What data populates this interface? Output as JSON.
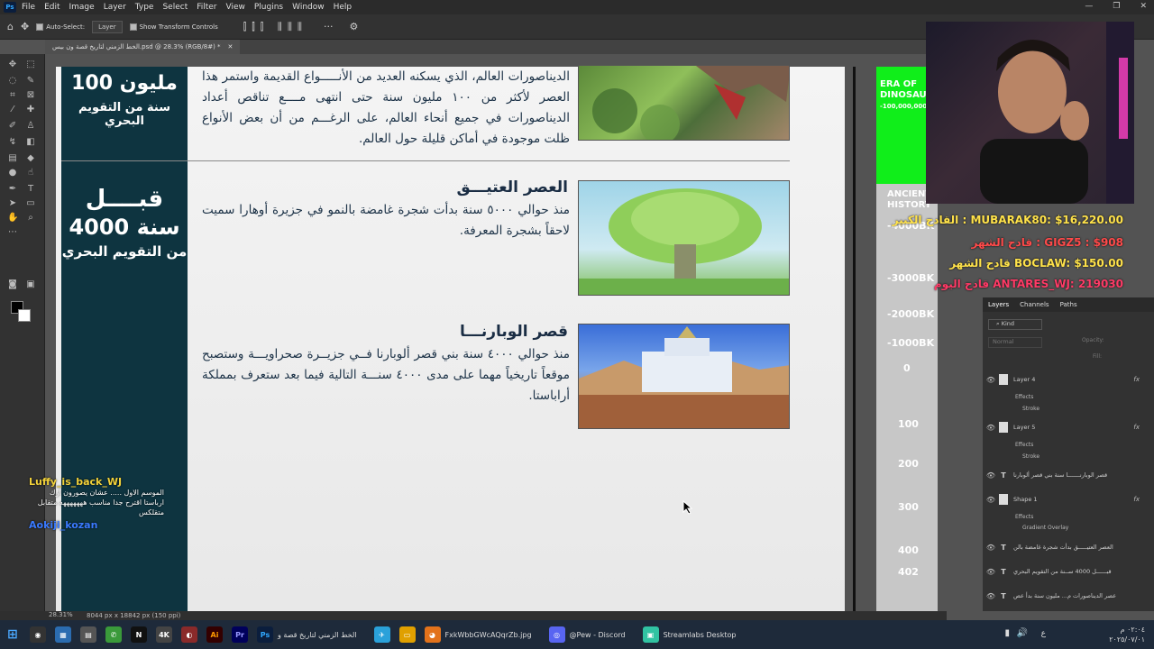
{
  "app": {
    "menu": [
      "File",
      "Edit",
      "Image",
      "Layer",
      "Type",
      "Select",
      "Filter",
      "View",
      "Plugins",
      "Window",
      "Help"
    ]
  },
  "options": {
    "auto_select_label": "Auto-Select:",
    "auto_select_value": "Layer",
    "transform_label": "Show Transform Controls"
  },
  "document": {
    "tab_title": "الخط الزمني لتاريخ قصة ون بيس.psd @ 28.3% (RGB/8#) *",
    "zoom": "28.31%",
    "doc_info": "8044 px x 18842 px (150 ppi)"
  },
  "canvas": {
    "side_top_big": "100 مليون",
    "side_top_small": "سنة من التقويم البحري",
    "side_mid_big1": "قبــــل",
    "side_mid_big2": "4000 سنة",
    "side_mid_small": "من التقويم البحري",
    "sections": [
      {
        "title": "",
        "body": "الديناصورات العالم، الذي يسكنه العديد من الأنـــــواع القديمة واستمر هذا العصر لأكثر من ١٠٠ مليون سنة حتى انتهى مــــع تناقص أعداد الديناصورات في جميع أنحاء العالم، على الرغـــم من أن بعض الأنواع ظلت موجودة في أماكن قليلة حول العالم."
      },
      {
        "title": "العصر العتيـــق",
        "body": "منذ حوالي ٥٠٠٠ سنة بدأت شجرة غامضة بالنمو في جزيرة أوهارا سميت لاحقاً بشجرة المعرفة."
      },
      {
        "title": "قصر الوبارنـــا",
        "body": "منذ حوالي ٤٠٠٠ سنة بني قصر ألوبارنا فــي جزيــرة صحراويـــة وستصبح موقعاً تاريخياً مهما على مدى ٤٠٠٠ سنـــة التالية فيما بعد ستعرف بمملكة أراباستا."
      }
    ]
  },
  "timeline": {
    "era_header": "ERA OF DINOSAURS",
    "era_years": "-100,000,000",
    "ancient": "ANCIENT HISTORY",
    "marks": [
      "-4000BK",
      "-3000BK",
      "-2000BK",
      "-1000BK",
      "0",
      "100",
      "200",
      "300",
      "400",
      "402"
    ]
  },
  "stream": {
    "donations": [
      {
        "text": "القادح الكبير : MUBARAK80: $16,220.00",
        "color": "#ffe24a"
      },
      {
        "text": "قادح الشهر : GIGZ5 : $908",
        "color": "#ff4a4a"
      },
      {
        "text": "قادح الشهر BOCLAW: $150.00",
        "color": "#ffe24a"
      },
      {
        "text": "قادح اليوم ANTARES_WJ: 219030",
        "color": "#ff3a66"
      }
    ],
    "chat": [
      {
        "user": "Luffy_is_back_WJ",
        "msg": "الموسم الاول ..... عشان يصورون ارك ارباستا اقترح جدا مناسب هههههههه متقابل متقلكس"
      },
      {
        "user": "Aokiji_kozan",
        "msg": ""
      }
    ]
  },
  "layers_panel": {
    "tabs": [
      "Layers",
      "Channels",
      "Paths"
    ],
    "filter": "Kind",
    "blend": "Normal",
    "opacity_label": "Opacity:",
    "fill_label": "Fill:",
    "items": [
      {
        "name": "Layer 4",
        "type": "img",
        "fx": true,
        "subs": [
          "Effects",
          "Stroke"
        ]
      },
      {
        "name": "Layer 5",
        "type": "img",
        "fx": true,
        "subs": [
          "Effects",
          "Stroke"
        ]
      },
      {
        "name": "قصر الوبارنـــــــا سنة بني قصر ألوبارنا",
        "type": "text",
        "fx": false,
        "subs": []
      },
      {
        "name": "Shape 1",
        "type": "shape",
        "fx": true,
        "subs": [
          "Effects",
          "Gradient Overlay"
        ]
      },
      {
        "name": "العصر العتيـــــق بدأت شجرة غامضة بالن",
        "type": "text",
        "fx": false,
        "subs": []
      },
      {
        "name": "قبــــــل 4000 ســنة من التقويم البحري",
        "type": "text",
        "fx": false,
        "subs": []
      },
      {
        "name": "عصر الديناصورات م... مليون سنة بدأ عص",
        "type": "text",
        "fx": false,
        "subs": []
      }
    ]
  },
  "taskbar": {
    "apps": [
      {
        "label": "الخط الزمني لتاريخ قصة و",
        "color": "#0b1e3d",
        "glyph": "Ps"
      },
      {
        "label": "FxkWbbGWcAQqrZb.jpg",
        "color": "#e2721b",
        "glyph": "F"
      },
      {
        "label": "@Pew - Discord",
        "color": "#5865f2",
        "glyph": "D"
      },
      {
        "label": "Streamlabs Desktop",
        "color": "#31c3a2",
        "glyph": "S"
      }
    ],
    "time": "٠٢:٠٤ م",
    "date": "٢٠٢٥/٠٧/٠١",
    "lang": "ع"
  }
}
